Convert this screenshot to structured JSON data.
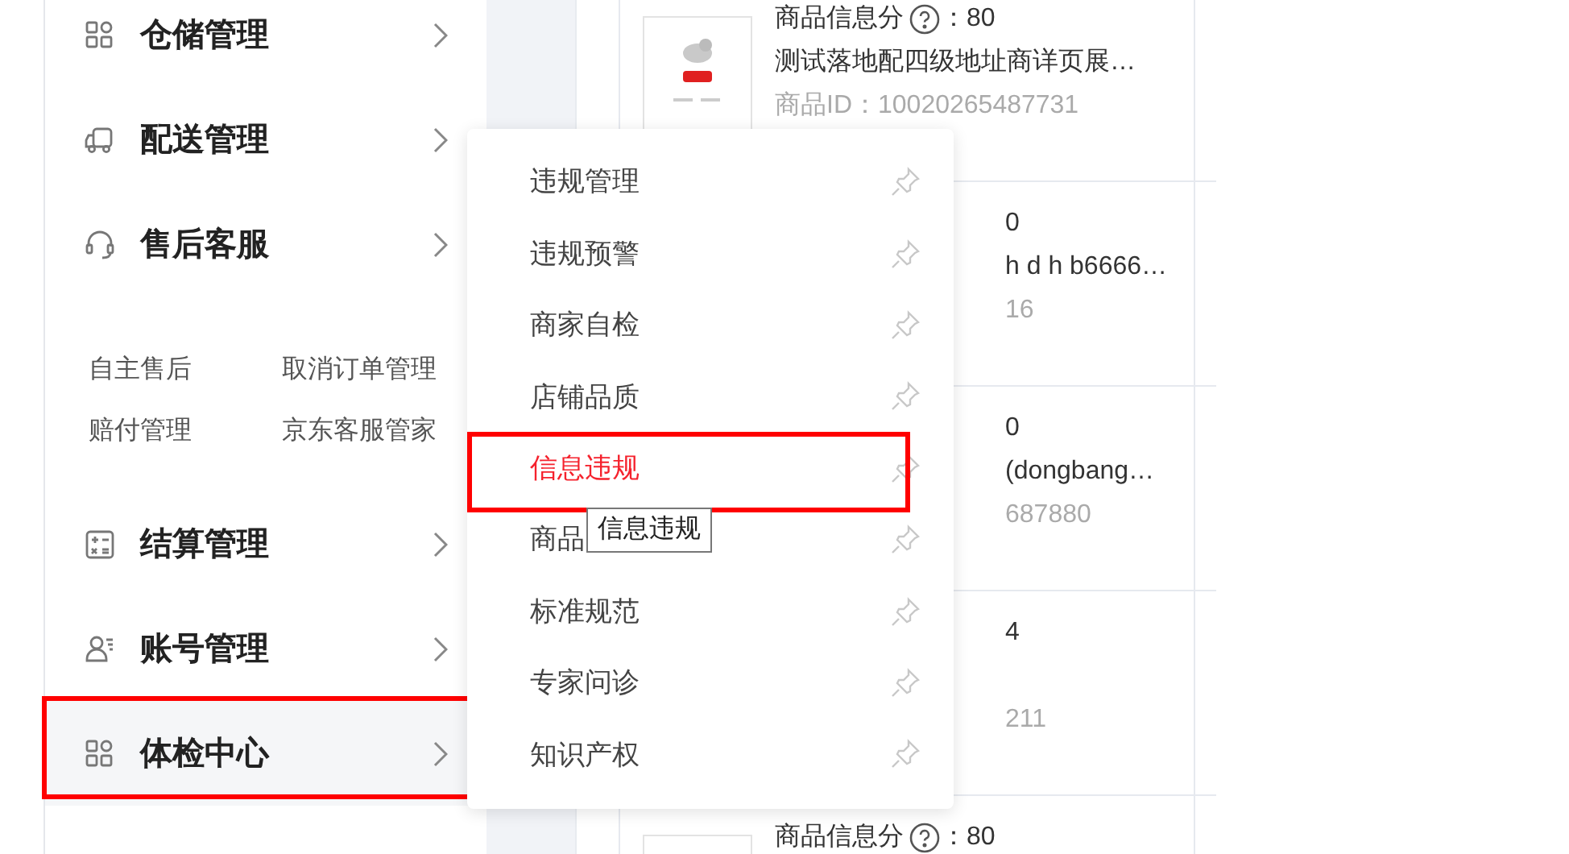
{
  "sidebar": {
    "items": [
      {
        "kind": "menu",
        "label": "仓储管理",
        "selected": false,
        "annotated": false
      },
      {
        "kind": "menu",
        "label": "配送管理",
        "selected": false,
        "annotated": false
      },
      {
        "kind": "menu",
        "label": "售后客服",
        "selected": false,
        "annotated": false
      },
      {
        "kind": "links",
        "links": [
          "自主售后",
          "取消订单管理",
          "赔付管理",
          "京东客服管家"
        ]
      },
      {
        "kind": "menu",
        "label": "结算管理",
        "selected": false,
        "annotated": false
      },
      {
        "kind": "menu",
        "label": "账号管理",
        "selected": false,
        "annotated": false
      },
      {
        "kind": "menu",
        "label": "体检中心",
        "selected": true,
        "annotated": true
      }
    ]
  },
  "flyout": {
    "items": [
      {
        "label": "违规管理",
        "hovered": false,
        "annotated": false
      },
      {
        "label": "违规预警",
        "hovered": false,
        "annotated": false
      },
      {
        "label": "商家自检",
        "hovered": false,
        "annotated": false
      },
      {
        "label": "店铺品质",
        "hovered": false,
        "annotated": false
      },
      {
        "label": "信息违规",
        "hovered": true,
        "annotated": true
      },
      {
        "label": "商品",
        "hovered": false,
        "annotated": false
      },
      {
        "label": "标准规范",
        "hovered": false,
        "annotated": false
      },
      {
        "label": "专家问诊",
        "hovered": false,
        "annotated": false
      },
      {
        "label": "知识产权",
        "hovered": false,
        "annotated": false
      }
    ],
    "tooltip": "信息违规"
  },
  "products": [
    {
      "kind": "full",
      "score_label": "商品信息分",
      "score": "：80",
      "title": "测试落地配四级地址商详页展…",
      "product_id": "商品ID：10020265487731"
    },
    {
      "kind": "partial",
      "score": "0",
      "title": "h d h b6666…",
      "product_id": "16"
    },
    {
      "kind": "partial",
      "score": "0",
      "title": "(dongbang…",
      "product_id": "687880"
    },
    {
      "kind": "partial",
      "score": "4",
      "product_id": "211"
    },
    {
      "kind": "full",
      "score_label": "商品信息分",
      "score": "：80"
    }
  ]
}
